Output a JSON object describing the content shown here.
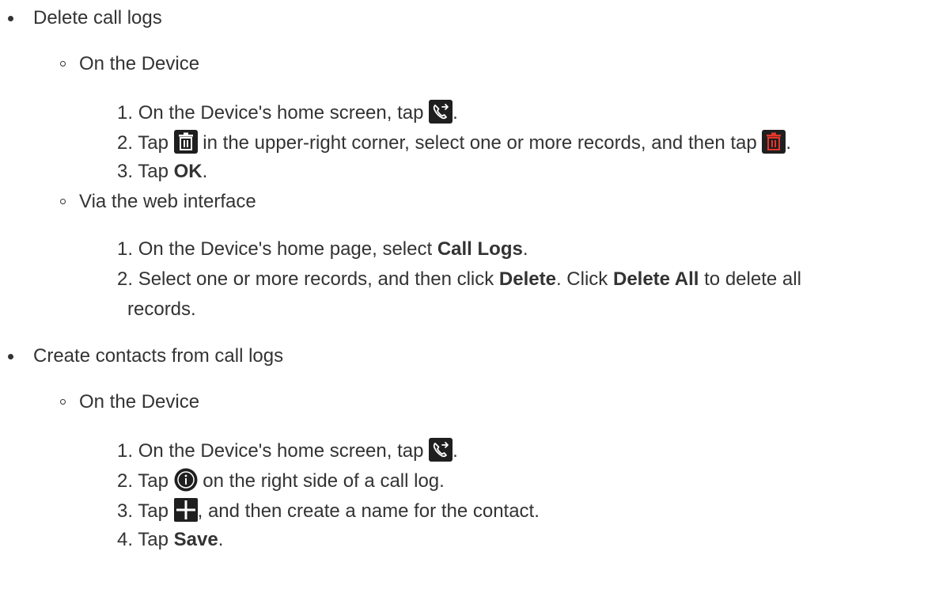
{
  "sections": [
    {
      "title": "Delete call logs",
      "sub": [
        {
          "title": "On the Device",
          "steps": [
            {
              "num": "1.",
              "pre": "On the Device's home screen, tap",
              "post": "."
            },
            {
              "num": "2.",
              "pre": "Tap",
              "mid": "in the upper-right corner, select one or more records, and then tap",
              "post": "."
            },
            {
              "num": "3.",
              "pre": "Tap",
              "bold": "OK",
              "post": "."
            }
          ]
        },
        {
          "title": "Via the web interface",
          "steps": [
            {
              "num": "1.",
              "pre": "On the Device's home page, select",
              "bold": "Call Logs",
              "post": "."
            },
            {
              "num": "2.",
              "pre": "Select one or more records, and then click",
              "bold": "Delete",
              "mid": ". Click",
              "bold2": "Delete All",
              "post": "to delete all",
              "cont": "records."
            }
          ]
        }
      ]
    },
    {
      "title": "Create contacts from call logs",
      "sub": [
        {
          "title": "On the Device",
          "steps": [
            {
              "num": "1.",
              "pre": "On the Device's home screen, tap",
              "post": "."
            },
            {
              "num": "2.",
              "pre": "Tap",
              "post": "on the right side of a call log."
            },
            {
              "num": "3.",
              "pre": "Tap",
              "post": ", and then create a name for the contact."
            },
            {
              "num": "4.",
              "pre": "Tap",
              "bold": "Save",
              "post": "."
            }
          ]
        }
      ]
    }
  ],
  "icons": {
    "call_log": "call-log-icon",
    "trash": "trash-icon",
    "trash_red": "trash-red-icon",
    "info": "info-icon",
    "add": "add-icon"
  },
  "colors": {
    "text": "#333333",
    "icon_dark": "#1f1f1f",
    "icon_accent": "#e5352b"
  }
}
